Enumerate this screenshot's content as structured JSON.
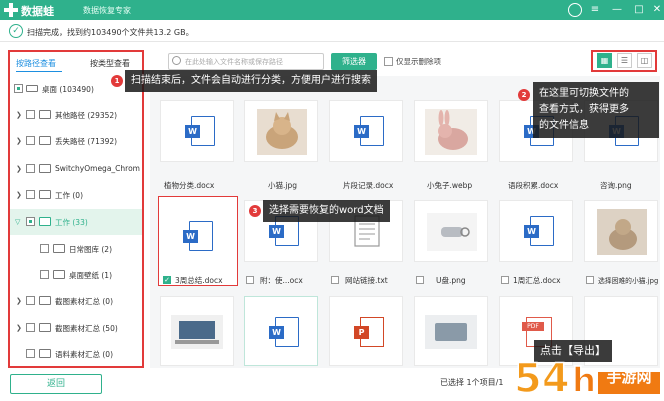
{
  "app": {
    "name": "数据蛙",
    "subtitle": "数据恢复专家"
  },
  "status": {
    "message": "扫描完成，找到约103490个文件共13.2 GB。"
  },
  "sidebar": {
    "tabs": [
      "按路径查看",
      "按类型查看"
    ],
    "tree": [
      {
        "label": "桌面 (103490)"
      },
      {
        "label": "其他路径 (29352)"
      },
      {
        "label": "丢失路径 (71392)"
      },
      {
        "label": "SwitchyOmega_Chromium"
      },
      {
        "label": "工作 (0)"
      },
      {
        "label": "工作 (33)"
      },
      {
        "label": "日常图库 (2)"
      },
      {
        "label": "桌面壁纸 (1)"
      },
      {
        "label": "截图素材汇总 (0)"
      },
      {
        "label": "截图素材汇总 (50)"
      },
      {
        "label": "语料素材汇总 (0)"
      }
    ],
    "back_label": "返回"
  },
  "toolbar": {
    "search_placeholder": "在此处输入文件名称或保存路径",
    "filter_label": "筛选器",
    "deleted_only_label": "仅显示删除项"
  },
  "files": [
    {
      "name": "植物分类.docx"
    },
    {
      "name": "小猫.jpg"
    },
    {
      "name": "片段记录.docx"
    },
    {
      "name": "小兔子.webp"
    },
    {
      "name": "语段积累.docx"
    },
    {
      "name": "咨询.png"
    },
    {
      "name": "3周总结.docx"
    },
    {
      "name": "附：使...ocx"
    },
    {
      "name": "网站链接.txt"
    },
    {
      "name": "U盘.png"
    },
    {
      "name": "1周汇总.docx"
    },
    {
      "name": "选择困难的小猫.jpg"
    }
  ],
  "callouts": {
    "c1": {
      "num": "1",
      "text": "扫描结束后，文件会自动进行分类，方便用户进行搜索"
    },
    "c2": {
      "num": "2",
      "line1": "在这里可切换文件的",
      "line2": "查看方式，获得更多",
      "line3": "的文件信息"
    },
    "c3": {
      "num": "3",
      "text": "选择需要恢复的word文档"
    },
    "c4": {
      "text": "点击【导出】"
    }
  },
  "footer": {
    "selection_text": "已选择 1个项目/1"
  },
  "watermark": {
    "text": "手游网"
  },
  "colors": {
    "brand": "#2fb18c",
    "annotation": "#e23a3a",
    "word": "#2b6bc6"
  }
}
